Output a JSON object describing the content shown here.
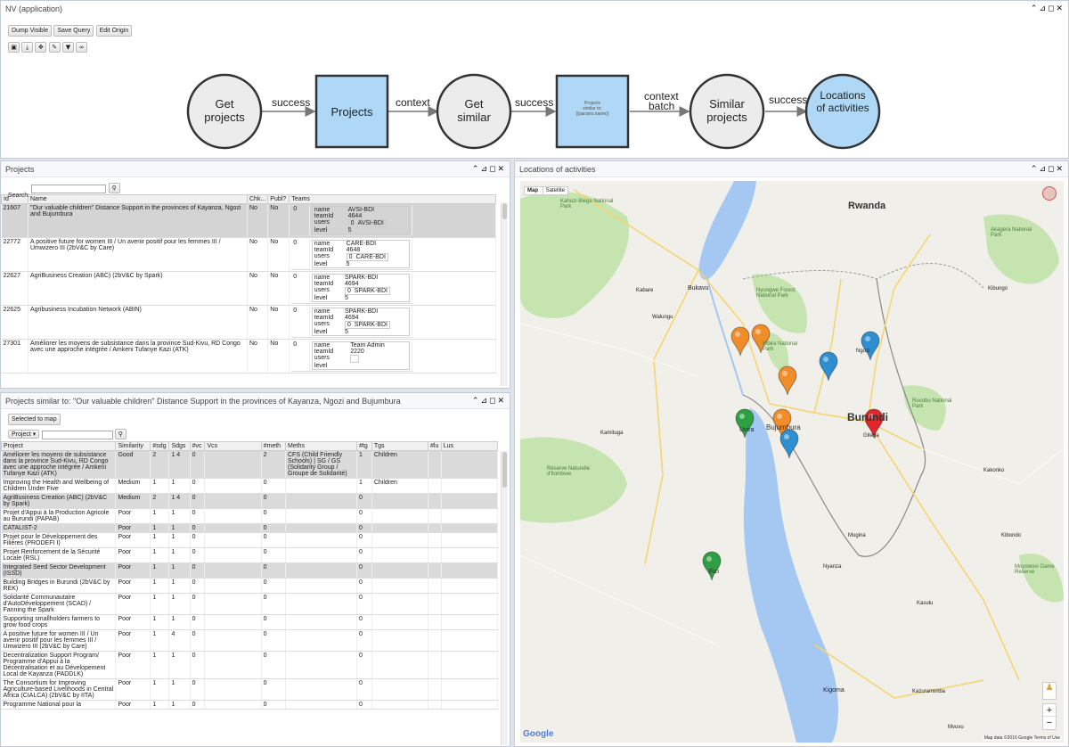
{
  "app": {
    "title": "NV (application)"
  },
  "toolbar": {
    "dump": "Dump Visible",
    "save": "Save Query",
    "edit": "Edit Origin",
    "icons": [
      "floppy",
      "download",
      "expand",
      "pin",
      "filter",
      "binoculars"
    ]
  },
  "window_controls": "⌃⊿◻✕",
  "flow": {
    "n1": "Get projects",
    "e1": "success",
    "n2": "Projects",
    "e2": "context",
    "n3": "Get similar",
    "e3": "success",
    "n4a": "Projects",
    "n4b": "similar to:",
    "n4c": "{{params.name}}",
    "e4a": "context",
    "e4b": "batch",
    "n5": "Similar projects",
    "e5": "success",
    "n6": "Locations of activities"
  },
  "projects": {
    "title": "Projects",
    "search_label": "Search:",
    "headers": [
      "Id",
      "Name",
      "Chk...",
      "Publ?",
      "Teams"
    ],
    "rows": [
      {
        "id": "21607",
        "name": "\"Our valuable children\" Distance Support in the provinces of Kayanza, Ngozi and Bujumbura",
        "chk": "No",
        "pub": "No",
        "t0": "0",
        "tname": "AVSI-BDI",
        "teamid": "4644",
        "uid": "0",
        "uname": "AVSI-BDI",
        "level": "5"
      },
      {
        "id": "22772",
        "name": "A positive future for women III / Un avenir positif pour les femmes III / Umwizero III (2bV&C by Care)",
        "chk": "No",
        "pub": "No",
        "t0": "0",
        "tname": "CARE-BDI",
        "teamid": "4648",
        "uid": "0",
        "uname": "CARE-BDI",
        "level": "5"
      },
      {
        "id": "22627",
        "name": "AgriBusiness Creation (ABC) (2bV&C by Spark)",
        "chk": "No",
        "pub": "No",
        "t0": "0",
        "tname": "SPARK-BDI",
        "teamid": "4694",
        "uid": "0",
        "uname": "SPARK-BDI",
        "level": "5"
      },
      {
        "id": "22625",
        "name": "Agribusiness Incubation Network (ABIN)",
        "chk": "No",
        "pub": "No",
        "t0": "0",
        "tname": "SPARK-BDI",
        "teamid": "4694",
        "uid": "0",
        "uname": "SPARK-BDI",
        "level": "5"
      },
      {
        "id": "27301",
        "name": "Améliorer les moyens de subsistance dans la province Sud-Kivu, RD Congo avec une approche intégrée / Amkeni Tufanye Kazi (ATK)",
        "chk": "No",
        "pub": "No",
        "t0": "0",
        "tname": "Team Admin",
        "teamid": "2220",
        "uid": "",
        "uname": "",
        "level": ""
      }
    ],
    "labels": {
      "name": "name",
      "teamid": "teamId",
      "users": "users",
      "level": "level"
    }
  },
  "similar": {
    "title": "Projects similar to: \"Our valuable children\" Distance Support in the provinces of Kayanza, Ngozi and Bujumbura",
    "selected_btn": "Selected to map",
    "filter_select": "Project",
    "headers": [
      "Project",
      "Similarity",
      "#sdg",
      "Sdgs",
      "#vc",
      "Vcs",
      "#meth",
      "Meths",
      "#tg",
      "Tgs",
      "#lu",
      "Lus"
    ],
    "rows": [
      [
        "Améliorer les moyens de subsistance dans la province Sud-Kivu, RD Congo avec une approche intégrée / Amkeni Tufanye Kazi (ATK)",
        "Good",
        "2",
        "1 4",
        "0",
        "",
        "2",
        "CFS (Child Friendly Schools) | SG / GS (Solidarity Group / Groupe de Solidarité)",
        "1",
        "Children",
        "",
        ""
      ],
      [
        "Improving the Health and Wellbeing of Children Under Five",
        "Medium",
        "1",
        "1",
        "0",
        "",
        "0",
        "",
        "1",
        "Children",
        "",
        ""
      ],
      [
        "AgriBusiness Creation (ABC) (2bV&C by Spark)",
        "Medium",
        "2",
        "1 4",
        "0",
        "",
        "0",
        "",
        "0",
        "",
        "",
        ""
      ],
      [
        "Projet d'Appui à la Production Agricole au Burundi (PAPAB)",
        "Poor",
        "1",
        "1",
        "0",
        "",
        "0",
        "",
        "0",
        "",
        "",
        ""
      ],
      [
        "CATALIST-2",
        "Poor",
        "1",
        "1",
        "0",
        "",
        "0",
        "",
        "0",
        "",
        "",
        ""
      ],
      [
        "Projet pour le Développement des Filières (PRODEFI I)",
        "Poor",
        "1",
        "1",
        "0",
        "",
        "0",
        "",
        "0",
        "",
        "",
        ""
      ],
      [
        "Projet Renforcement de la Sécurité Locale (RSL)",
        "Poor",
        "1",
        "1",
        "0",
        "",
        "0",
        "",
        "0",
        "",
        "",
        ""
      ],
      [
        "Integrated Seed Sector Development (ISSD)",
        "Poor",
        "1",
        "1",
        "0",
        "",
        "0",
        "",
        "0",
        "",
        "",
        ""
      ],
      [
        "Building Bridges in Burundi (2bV&C by REK)",
        "Poor",
        "1",
        "1",
        "0",
        "",
        "0",
        "",
        "0",
        "",
        "",
        ""
      ],
      [
        "Solidarité Communautaire d'AutoDéveloppement (SCAD) / Fanning the Spark",
        "Poor",
        "1",
        "1",
        "0",
        "",
        "0",
        "",
        "0",
        "",
        "",
        ""
      ],
      [
        "Supporting smallholders farmers to grow food crops",
        "Poor",
        "1",
        "1",
        "0",
        "",
        "0",
        "",
        "0",
        "",
        "",
        ""
      ],
      [
        "A positive future for women III / Un avenir positif pour les femmes III / Umwizero III (2bV&C by Care)",
        "Poor",
        "1",
        "4",
        "0",
        "",
        "0",
        "",
        "0",
        "",
        "",
        ""
      ],
      [
        "Decentralization Support Program/ Programme d'Appui à la Décentralisation et au Dévelopement Local de Kayanza (PADDLK)",
        "Poor",
        "1",
        "1",
        "0",
        "",
        "0",
        "",
        "0",
        "",
        "",
        ""
      ],
      [
        "The Consortium for Improving Agriculture-based Livelihoods in Central Africa (CIALCA) (2bV&C by IITA)",
        "Poor",
        "1",
        "1",
        "0",
        "",
        "0",
        "",
        "0",
        "",
        "",
        ""
      ],
      [
        "Programme National pour la",
        "Poor",
        "1",
        "1",
        "0",
        "",
        "0",
        "",
        "0",
        "",
        "",
        ""
      ]
    ]
  },
  "map": {
    "title": "Locations of activities",
    "tab_map": "Map",
    "tab_sat": "Satellite",
    "labels": {
      "rwanda": "Rwanda",
      "burundi": "Burundi",
      "bujumbura": "Bujumbura",
      "bukavu": "Bukavu",
      "uvira": "Uvira",
      "fizi": "Fizi",
      "kigoma": "Kigoma",
      "gitega": "Gitega",
      "ngozi": "Ngozi",
      "kibungo": "Kibungo",
      "kakonko": "Kakonko",
      "kasulu": "Kasulu",
      "kibondo": "Kibondo",
      "mugina": "Mugina",
      "nyanza": "Nyanza",
      "kabare": "Kabare",
      "walungu": "Walungu",
      "kamituga": "Kamituga",
      "kazuramimba": "Kazuramimba",
      "mvuvu": "Mvuvu",
      "reserve": "Réserve Naturelle d'Itombwe",
      "kahuzi": "Kahuzi-Biega National Park",
      "nyungwe": "Nyungwe Forest National Park",
      "kibira": "Kibira National Park",
      "akagera": "Akagera National Park",
      "ruvubu": "Ruvubu National Park",
      "moyowosi": "Moyowosi Game Reserve"
    },
    "google": "Google",
    "footer": "Map data ©2016 Google   Terms of Use",
    "marker_colors": {
      "orange": "#f08c2a",
      "blue": "#2e8fd0",
      "green": "#2ea043",
      "red": "#e0282c"
    },
    "water": "#a4c8f2",
    "park": "#c6e4b0",
    "land": "#f1efe9"
  }
}
